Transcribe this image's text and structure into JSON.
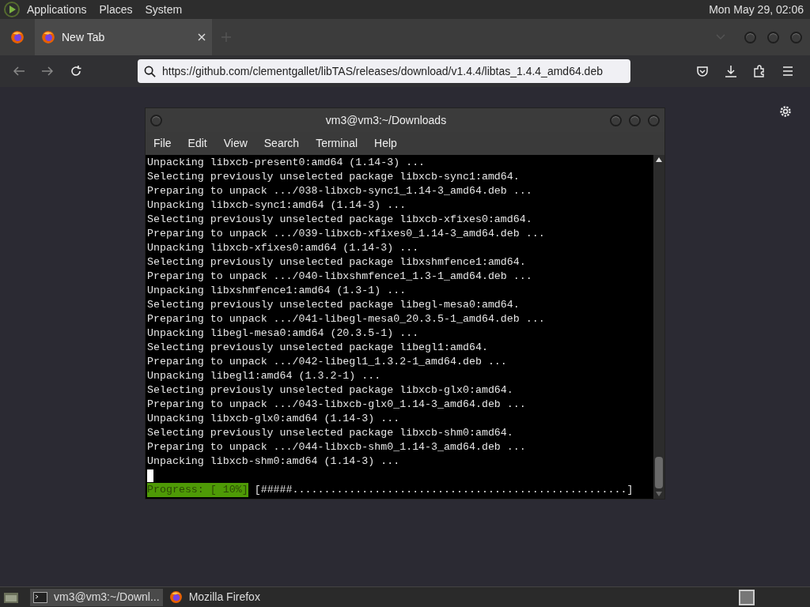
{
  "top_panel": {
    "menus": [
      "Applications",
      "Places",
      "System"
    ],
    "clock": "Mon May 29, 02:06"
  },
  "browser": {
    "tabs": [
      {
        "label": "New Tab",
        "selected": true
      }
    ],
    "url": "https://github.com/clementgallet/libTAS/releases/download/v1.4.4/libtas_1.4.4_amd64.deb"
  },
  "terminal": {
    "title": "vm3@vm3:~/Downloads",
    "menu": [
      "File",
      "Edit",
      "View",
      "Search",
      "Terminal",
      "Help"
    ],
    "lines": [
      "Unpacking libxcb-present0:amd64 (1.14-3) ...",
      "Selecting previously unselected package libxcb-sync1:amd64.",
      "Preparing to unpack .../038-libxcb-sync1_1.14-3_amd64.deb ...",
      "Unpacking libxcb-sync1:amd64 (1.14-3) ...",
      "Selecting previously unselected package libxcb-xfixes0:amd64.",
      "Preparing to unpack .../039-libxcb-xfixes0_1.14-3_amd64.deb ...",
      "Unpacking libxcb-xfixes0:amd64 (1.14-3) ...",
      "Selecting previously unselected package libxshmfence1:amd64.",
      "Preparing to unpack .../040-libxshmfence1_1.3-1_amd64.deb ...",
      "Unpacking libxshmfence1:amd64 (1.3-1) ...",
      "Selecting previously unselected package libegl-mesa0:amd64.",
      "Preparing to unpack .../041-libegl-mesa0_20.3.5-1_amd64.deb ...",
      "Unpacking libegl-mesa0:amd64 (20.3.5-1) ...",
      "Selecting previously unselected package libegl1:amd64.",
      "Preparing to unpack .../042-libegl1_1.3.2-1_amd64.deb ...",
      "Unpacking libegl1:amd64 (1.3.2-1) ...",
      "Selecting previously unselected package libxcb-glx0:amd64.",
      "Preparing to unpack .../043-libxcb-glx0_1.14-3_amd64.deb ...",
      "Unpacking libxcb-glx0:amd64 (1.14-3) ...",
      "Selecting previously unselected package libxcb-shm0:amd64.",
      "Preparing to unpack .../044-libxcb-shm0_1.14-3_amd64.deb ...",
      "Unpacking libxcb-shm0:amd64 (1.14-3) ..."
    ],
    "progress_label": "Progress: [ 10%]",
    "progress_bar": "[#####.....................................................]"
  },
  "taskbar": {
    "items": [
      {
        "label": "vm3@vm3:~/Downl...",
        "kind": "terminal",
        "selected": true
      },
      {
        "label": "Mozilla Firefox",
        "kind": "firefox",
        "selected": false
      }
    ]
  }
}
